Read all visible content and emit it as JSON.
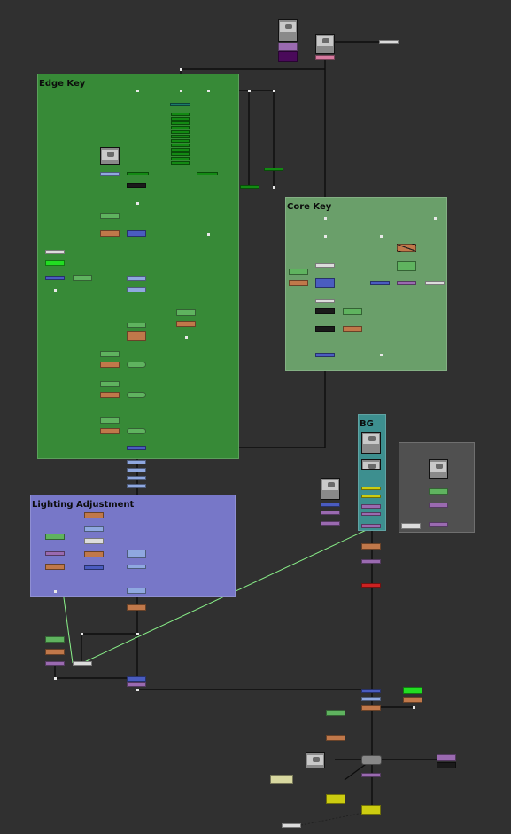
{
  "backdrops": {
    "edge_key": {
      "label": "Edge Key",
      "color": "#378a37"
    },
    "core_key": {
      "label": "Core Key",
      "color": "#6a9f6a"
    },
    "lighting": {
      "label": "Lighting Adjustment",
      "color": "#7777c8"
    },
    "bg": {
      "label": "BG",
      "color": "#3d8f8f"
    },
    "unnamed": {
      "label": "",
      "color": "#505050"
    }
  },
  "colors": {
    "wire": "#0d0d0d",
    "wire_highlight": "#88ee88",
    "dot": "#e8e8e8",
    "node_green": "#5fb35f",
    "node_dark_green": "#138a13",
    "node_teal": "#1a7a6a",
    "node_orange": "#c0784a",
    "node_blue": "#4a5cc0",
    "node_light_blue": "#8fa8e0",
    "node_purple": "#9a6ab0",
    "node_red": "#cc2222",
    "node_white": "#dcdcdc",
    "node_black": "#1a1a1a",
    "node_yellow": "#cccc10",
    "node_bright_green": "#22dd22"
  }
}
